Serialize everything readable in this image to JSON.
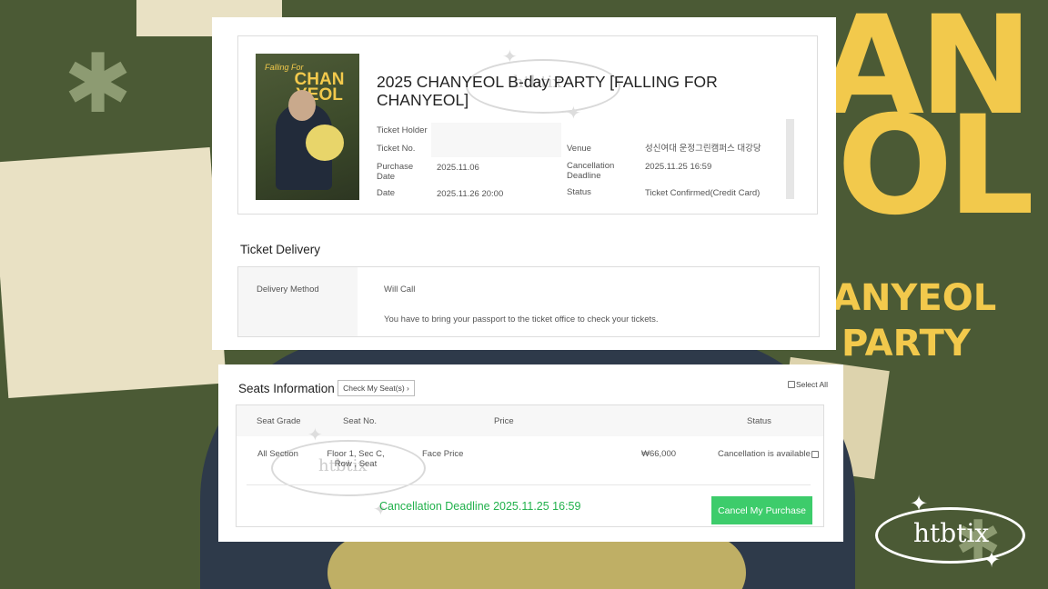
{
  "background": {
    "big_letters_1": "AN",
    "big_letters_2": "OL",
    "subtitle_1": "ANYEOL",
    "subtitle_2": "PARTY",
    "brand_logo": "htbtix"
  },
  "ticket": {
    "poster": {
      "line1": "Falling For",
      "line2": "CHAN YEOL"
    },
    "title": "2025 CHANYEOL B-day PARTY [FALLING FOR CHANYEOL]",
    "labels": {
      "holder": "Ticket Holder",
      "number": "Ticket No.",
      "purchase_date": "Purchase Date",
      "date": "Date",
      "venue": "Venue",
      "cancel_deadline": "Cancellation Deadline",
      "status": "Status"
    },
    "values": {
      "purchase_date": "2025.11.06",
      "date": "2025.11.26 20:00",
      "venue": "성신여대 운정그린캠퍼스 대강당",
      "cancel_deadline": "2025.11.25 16:59",
      "status": "Ticket Confirmed(Credit Card)"
    }
  },
  "delivery": {
    "section_title": "Ticket Delivery",
    "method_label": "Delivery Method",
    "method_value": "Will Call",
    "note": "You have to bring your passport to the ticket office to check your tickets."
  },
  "seats": {
    "section_title": "Seats Information",
    "check_button": "Check My Seat(s)",
    "select_all": "Select All",
    "columns": [
      "Seat Grade",
      "Seat No.",
      "Price",
      "Status"
    ],
    "rows": [
      {
        "grade": "All Section",
        "seat_no": "Floor 1, Sec C, Row , Seat",
        "price_type": "Face Price",
        "price": "₩66,000",
        "status": "Cancellation is available"
      }
    ],
    "deadline_text": "Cancellation Deadline 2025.11.25 16:59",
    "cancel_button": "Cancel My Purchase"
  },
  "watermark": "htbtix",
  "colors": {
    "accent_green": "#3dcc6b",
    "deadline_green": "#22b14c",
    "background_olive": "#4b5a35",
    "brand_yellow": "#f2c94c"
  }
}
